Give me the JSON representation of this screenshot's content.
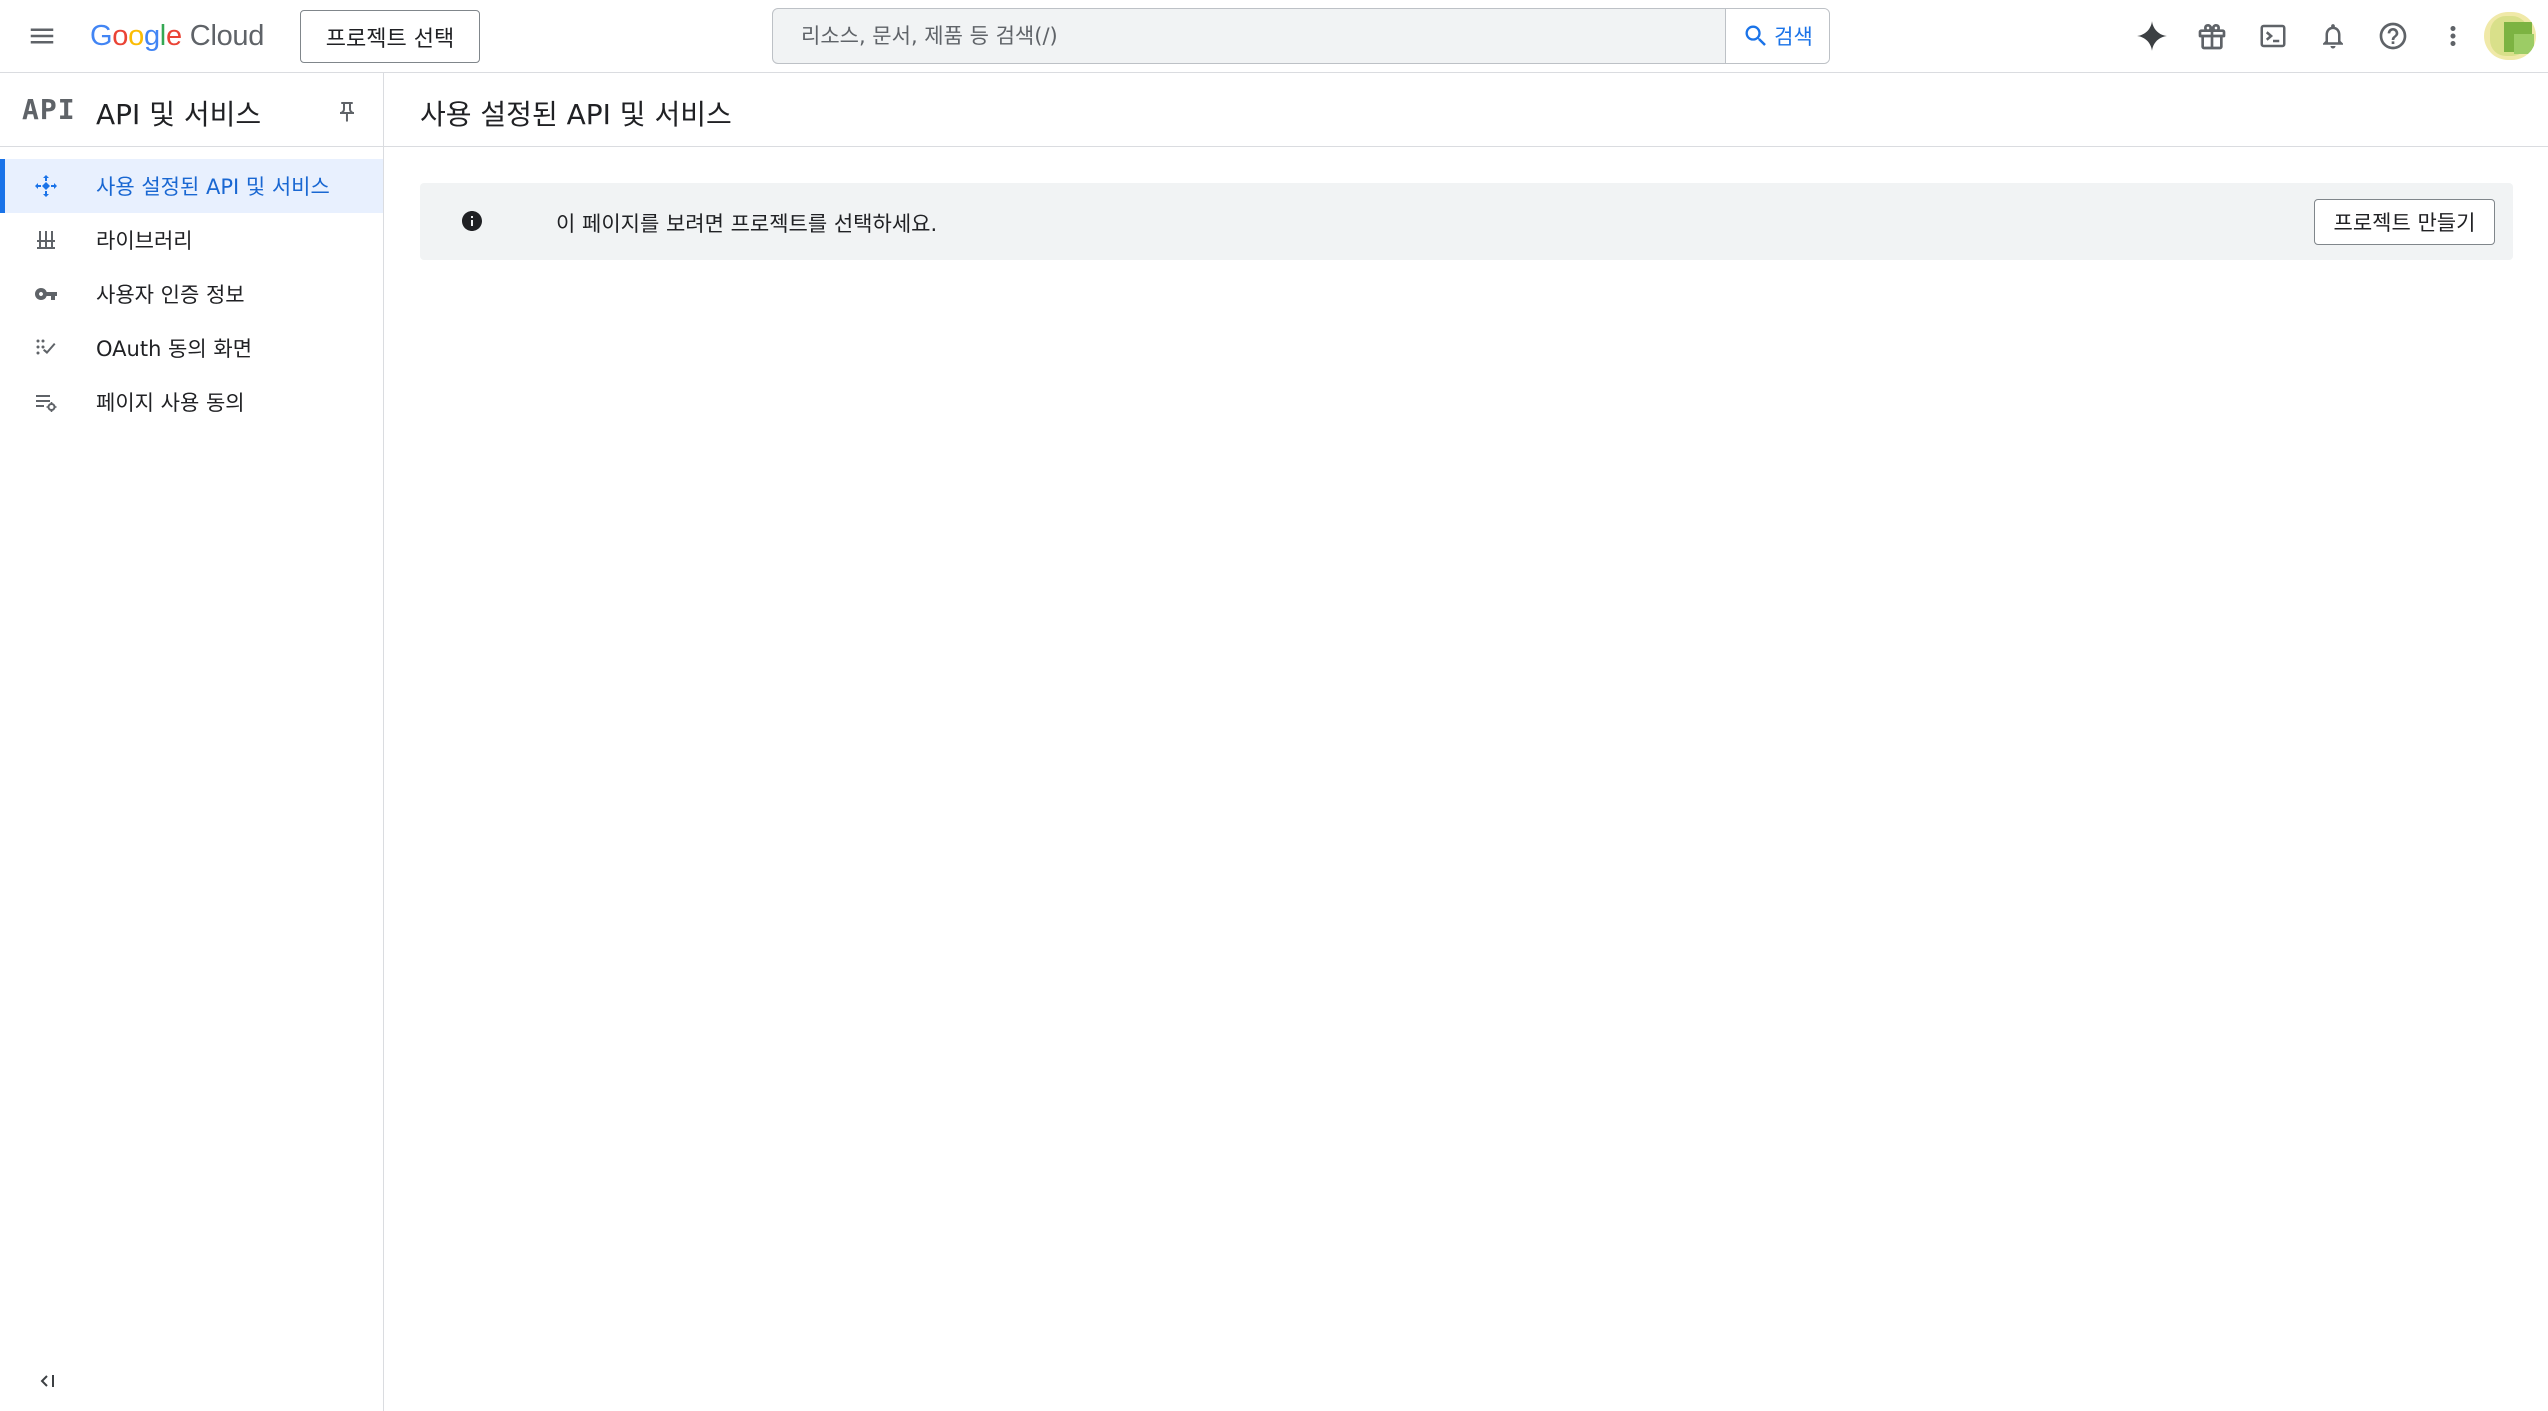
{
  "topbar": {
    "logo_google": "Google",
    "logo_cloud": "Cloud",
    "project_selector_label": "프로젝트 선택",
    "search_placeholder": "리소스, 문서, 제품 등 검색(/)",
    "search_button_label": "검색",
    "icons": [
      "menu-icon",
      "gemini-sparkle-icon",
      "gift-icon",
      "cloud-shell-terminal-icon",
      "notifications-bell-icon",
      "help-icon",
      "more-vert-icon",
      "account-avatar"
    ]
  },
  "sidebar": {
    "logo_text": "API",
    "title": "API 및 서비스",
    "items": [
      {
        "label": "사용 설정된 API 및 서비스",
        "icon": "enabled-apis-icon",
        "active": true
      },
      {
        "label": "라이브러리",
        "icon": "library-icon",
        "active": false
      },
      {
        "label": "사용자 인증 정보",
        "icon": "key-icon",
        "active": false
      },
      {
        "label": "OAuth 동의 화면",
        "icon": "oauth-consent-icon",
        "active": false
      },
      {
        "label": "페이지 사용 동의",
        "icon": "page-usage-agreement-icon",
        "active": false
      }
    ]
  },
  "main": {
    "page_title": "사용 설정된 API 및 서비스",
    "notice": {
      "text": "이 페이지를 보려면 프로젝트를 선택하세요.",
      "button_label": "프로젝트 만들기"
    }
  },
  "colors": {
    "accent": "#1a73e8",
    "active_bg": "#e8f0fe",
    "notice_bg": "#f1f3f4",
    "border": "#dadce0"
  }
}
